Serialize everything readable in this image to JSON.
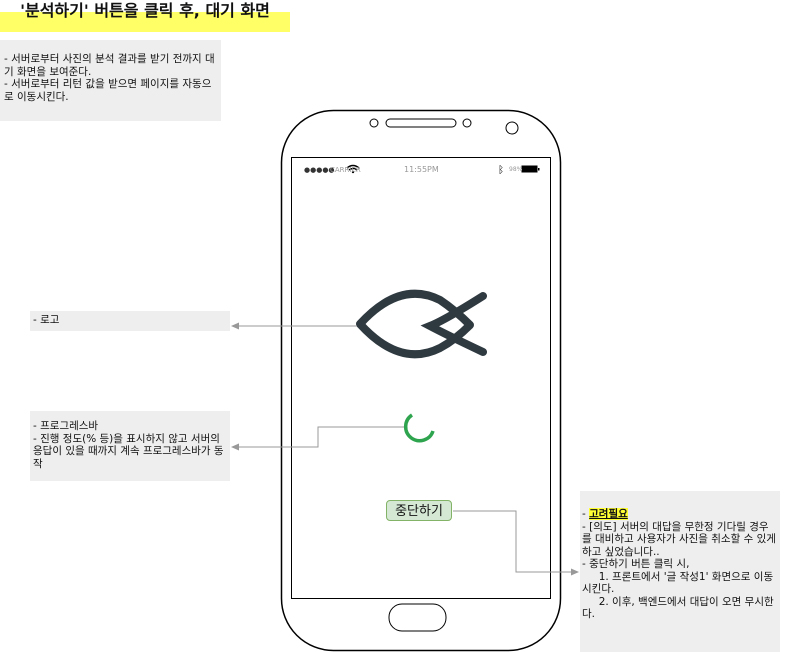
{
  "title": "'분석하기' 버튼을 클릭 후, 대기 화면",
  "description": "- 서버로부터 사진의 분석 결과를 받기 전까지 대기 화면을 보여준다.\n- 서버로부터 리턴 값을 받으면 페이지를 자동으로 이동시킨다.",
  "status_bar": {
    "carrier": "CARRIER",
    "time": "11:55PM",
    "battery": "98%"
  },
  "notes": {
    "logo": "- 로고",
    "progress": "- 프로그레스바\n- 진행 정도(% 등)을 표시하지 않고 서버의 응답이 있을 때까지 계속 프로그레스바가 동작",
    "cancel_prefix": "- ",
    "cancel_highlight": "고려필요",
    "cancel_body": "- [의도] 서버의 대답을 무한정 기다릴 경우를 대비하고 사용자가 사진을 취소할 수 있게 하고 싶었습니다..\n- 중단하기 버튼 클릭 시,\n     1. 프론트에서 '글 작성1' 화면으로 이동시킨다.\n     2. 이후, 백엔드에서 대답이 오면 무시한다."
  },
  "cancel_button": "중단하기",
  "colors": {
    "highlight": "#ffff66",
    "spinner": "#2ea44f",
    "logo": "#2f3a40",
    "button_bg": "#d5e8d4"
  }
}
